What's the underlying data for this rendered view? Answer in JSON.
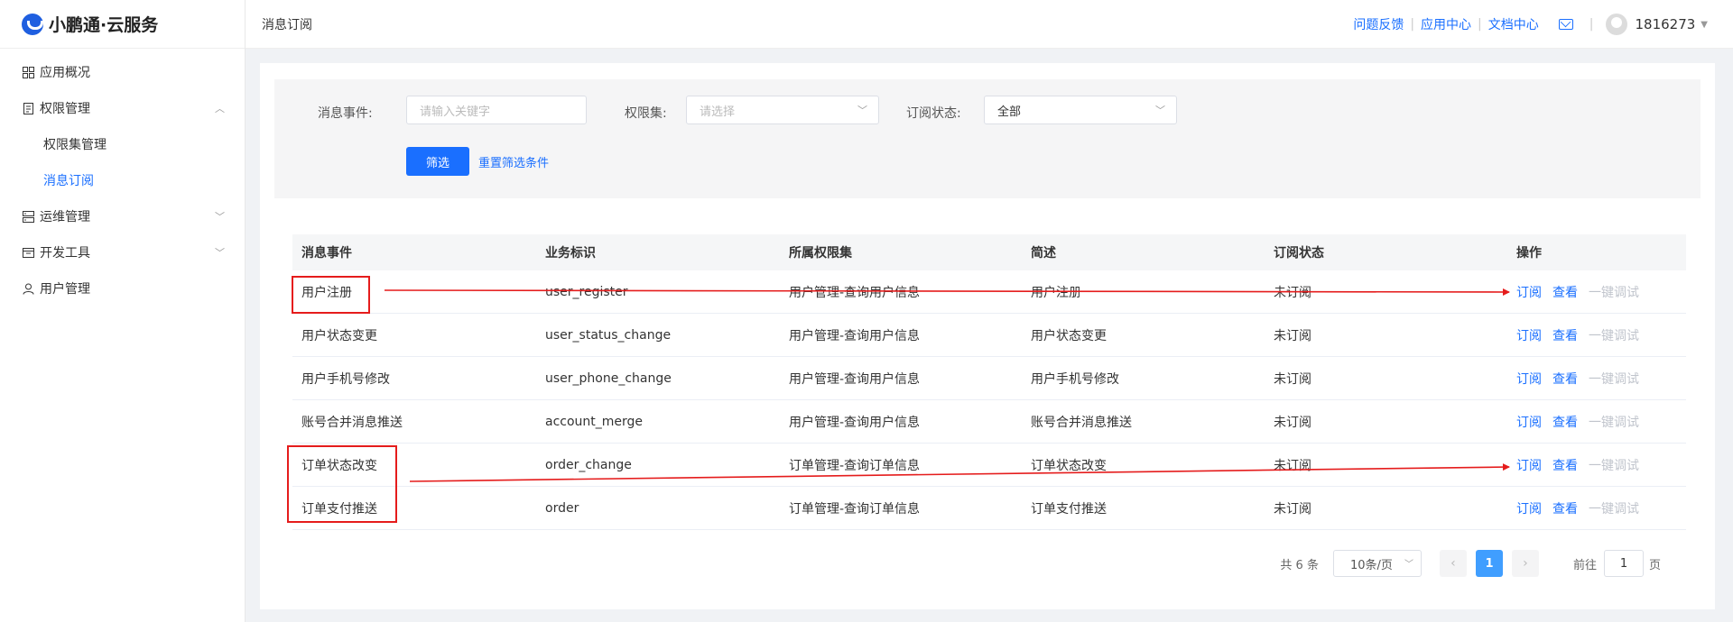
{
  "app": {
    "logo_text": "小鹏通·云服务"
  },
  "sidebar": {
    "items": [
      {
        "label": "应用概况",
        "icon": "grid-icon"
      },
      {
        "label": "权限管理",
        "icon": "document-icon",
        "expanded": true,
        "children": [
          {
            "label": "权限集管理"
          },
          {
            "label": "消息订阅",
            "active": true
          }
        ]
      },
      {
        "label": "运维管理",
        "icon": "server-icon"
      },
      {
        "label": "开发工具",
        "icon": "tool-icon"
      },
      {
        "label": "用户管理",
        "icon": "user-icon"
      }
    ]
  },
  "header": {
    "title": "消息订阅",
    "links": [
      "问题反馈",
      "应用中心",
      "文档中心"
    ],
    "user": "1816273"
  },
  "filters": {
    "event": {
      "label": "消息事件:",
      "placeholder": "请输入关键字"
    },
    "permission_set": {
      "label": "权限集:",
      "placeholder": "请选择"
    },
    "status": {
      "label": "订阅状态:",
      "value": "全部"
    },
    "filter_button": "筛选",
    "reset_link": "重置筛选条件"
  },
  "table": {
    "headers": [
      "消息事件",
      "业务标识",
      "所属权限集",
      "简述",
      "订阅状态",
      "操作"
    ],
    "rows": [
      {
        "event": "用户注册",
        "key": "user_register",
        "perm": "用户管理-查询用户信息",
        "desc": "用户注册",
        "status": "未订阅"
      },
      {
        "event": "用户状态变更",
        "key": "user_status_change",
        "perm": "用户管理-查询用户信息",
        "desc": "用户状态变更",
        "status": "未订阅"
      },
      {
        "event": "用户手机号修改",
        "key": "user_phone_change",
        "perm": "用户管理-查询用户信息",
        "desc": "用户手机号修改",
        "status": "未订阅"
      },
      {
        "event": "账号合并消息推送",
        "key": "account_merge",
        "perm": "用户管理-查询用户信息",
        "desc": "账号合并消息推送",
        "status": "未订阅"
      },
      {
        "event": "订单状态改变",
        "key": "order_change",
        "perm": "订单管理-查询订单信息",
        "desc": "订单状态改变",
        "status": "未订阅"
      },
      {
        "event": "订单支付推送",
        "key": "order",
        "perm": "订单管理-查询订单信息",
        "desc": "订单支付推送",
        "status": "未订阅"
      }
    ],
    "actions": {
      "subscribe": "订阅",
      "view": "查看",
      "debug": "一键调试"
    }
  },
  "pagination": {
    "total": "共 6 条",
    "page_size": "10条/页",
    "current": "1",
    "goto_label": "前往",
    "goto_value": "1",
    "page_suffix": "页"
  },
  "colors": {
    "accent": "#1a6fff",
    "annotation": "#e51c1c"
  }
}
